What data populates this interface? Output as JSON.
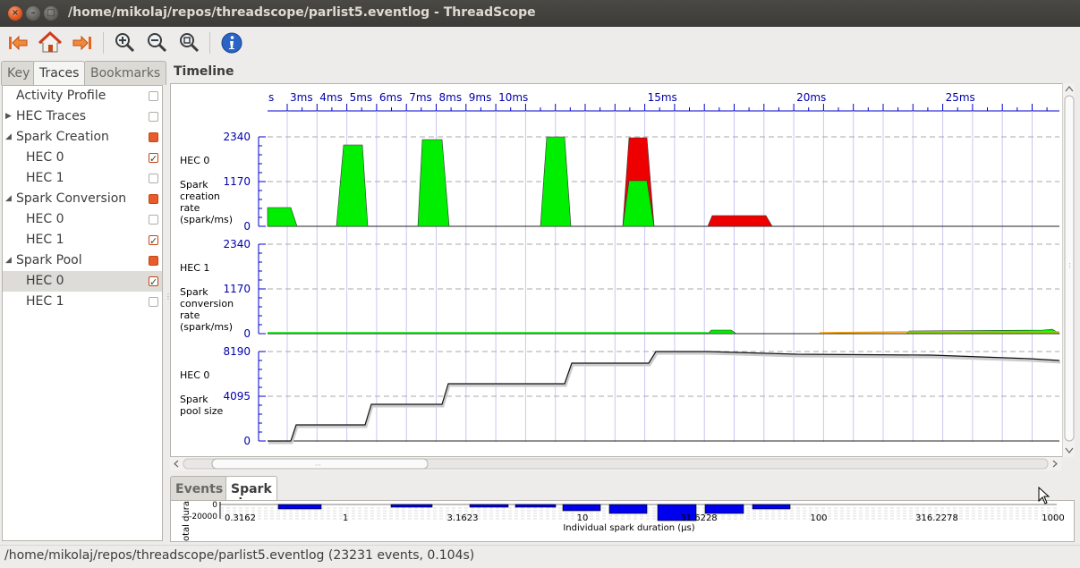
{
  "window": {
    "title": "/home/mikolaj/repos/threadscope/parlist5.eventlog - ThreadScope",
    "close_glyph": "×",
    "min_glyph": "–",
    "max_glyph": "□"
  },
  "toolbar": {
    "buttons": [
      "first-icon",
      "home-icon",
      "last-icon",
      "zoom-in-icon",
      "zoom-out-icon",
      "zoom-fit-icon",
      "info-icon"
    ]
  },
  "left_tabs": [
    {
      "label": "Key",
      "active": false
    },
    {
      "label": "Traces",
      "active": true
    },
    {
      "label": "Bookmarks",
      "active": false
    }
  ],
  "traces": [
    {
      "label": "Activity Profile",
      "level": 0,
      "expander": "",
      "checkbox": "empty"
    },
    {
      "label": "HEC Traces",
      "level": 0,
      "expander": "▶",
      "checkbox": "empty"
    },
    {
      "label": "Spark Creation",
      "level": 0,
      "expander": "◢",
      "checkbox": "partial"
    },
    {
      "label": "HEC 0",
      "level": 1,
      "expander": "",
      "checkbox": "checked"
    },
    {
      "label": "HEC 1",
      "level": 1,
      "expander": "",
      "checkbox": "empty"
    },
    {
      "label": "Spark Conversion",
      "level": 0,
      "expander": "◢",
      "checkbox": "partial"
    },
    {
      "label": "HEC 0",
      "level": 1,
      "expander": "",
      "checkbox": "empty"
    },
    {
      "label": "HEC 1",
      "level": 1,
      "expander": "",
      "checkbox": "checked"
    },
    {
      "label": "Spark Pool",
      "level": 0,
      "expander": "◢",
      "checkbox": "partial"
    },
    {
      "label": "HEC 0",
      "level": 1,
      "expander": "",
      "checkbox": "checked",
      "selected": true
    },
    {
      "label": "HEC 1",
      "level": 1,
      "expander": "",
      "checkbox": "empty"
    }
  ],
  "timeline": {
    "label": "Timeline",
    "ruler_labels": [
      "3ms",
      "4ms",
      "5ms",
      "6ms",
      "7ms",
      "8ms",
      "9ms",
      "10ms",
      "15ms",
      "20ms",
      "25ms"
    ],
    "ruler_edge_fragment": "s",
    "tracks": [
      {
        "hec": "HEC 0",
        "lines": [
          "Spark",
          "creation",
          "rate",
          "(spark/ms)"
        ],
        "y_max": "2340",
        "y_mid": "1170",
        "y_min": "0"
      },
      {
        "hec": "HEC 1",
        "lines": [
          "Spark",
          "conversion",
          "rate",
          "(spark/ms)"
        ],
        "y_max": "2340",
        "y_mid": "1170",
        "y_min": "0"
      },
      {
        "hec": "HEC 0",
        "lines": [
          "Spark",
          "pool size"
        ],
        "y_max": "8190",
        "y_mid": "4095",
        "y_min": "0"
      }
    ],
    "colors": {
      "green": "#00ee00",
      "red": "#ee0000",
      "axis": "#0000cc",
      "orange": "#ffa500"
    }
  },
  "bottom_tabs": [
    {
      "label": "Events",
      "active": false
    },
    {
      "label": "Spark sizes",
      "active": true
    }
  ],
  "spark_sizes": {
    "x_ticks": [
      "0.3162",
      "1",
      "3.1623",
      "10",
      "31.6228",
      "100",
      "316.2278",
      "1000"
    ],
    "xlabel": "Individual spark duration (µs)",
    "ylabel_fragment": "otal dura",
    "y_top": "0",
    "y_bottom": "-20000"
  },
  "status": {
    "text": "/home/mikolaj/repos/threadscope/parlist5.eventlog (23231 events, 0.104s)"
  }
}
